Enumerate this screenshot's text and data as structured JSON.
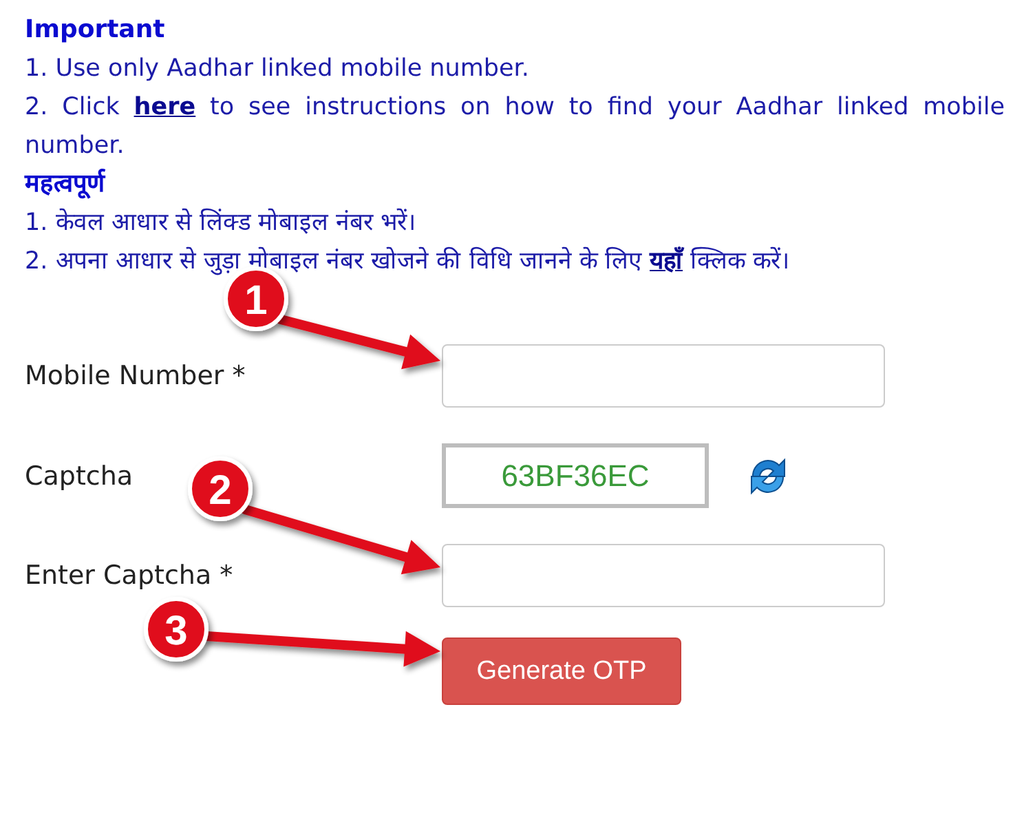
{
  "notice_en": {
    "heading": "Important",
    "lines": [
      {
        "before": "1. Use only Aadhar linked mobile number."
      },
      {
        "before": "2. Click",
        "link": "here",
        "after": "to see instructions on how to find your Aadhar linked mobile number."
      }
    ]
  },
  "notice_hi": {
    "heading": "महत्वपूर्ण",
    "lines": [
      {
        "before": "1. केवल आधार से लिंक्ड मोबाइल नंबर भरें।"
      },
      {
        "before": "2. अपना आधार से जुड़ा मोबाइल नंबर खोजने की विधि जानने के लिए",
        "link": "यहाँ",
        "after": "क्लिक करें।"
      }
    ]
  },
  "form": {
    "rows": [
      {
        "kind": "input",
        "label": "Mobile Number *"
      },
      {
        "kind": "captcha",
        "label": "Captcha",
        "code": "63BF36EC"
      },
      {
        "kind": "input",
        "label": "Enter Captcha *"
      }
    ],
    "submit": "Generate OTP"
  },
  "annotations": [
    {
      "label": "1"
    },
    {
      "label": "2"
    },
    {
      "label": "3"
    }
  ]
}
